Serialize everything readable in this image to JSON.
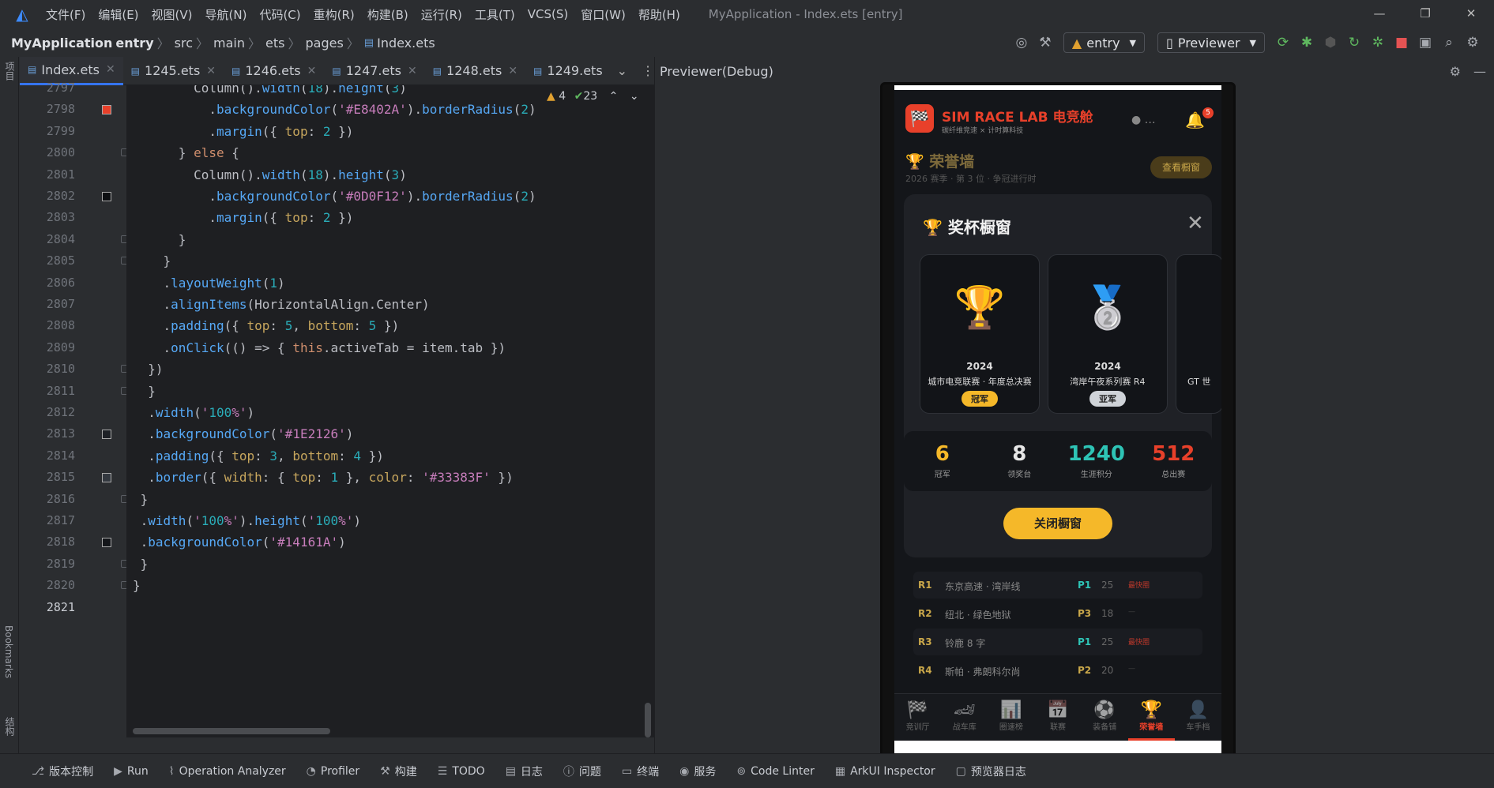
{
  "menubar": {
    "items": [
      "文件(F)",
      "编辑(E)",
      "视图(V)",
      "导航(N)",
      "代码(C)",
      "重构(R)",
      "构建(B)",
      "运行(R)",
      "工具(T)",
      "VCS(S)",
      "窗口(W)",
      "帮助(H)"
    ],
    "window_title": "MyApplication - Index.ets [entry]"
  },
  "breadcrumb": {
    "project": "MyApplication",
    "module": "entry",
    "p1": "src",
    "p2": "main",
    "p3": "ets",
    "p4": "pages",
    "file": "Index.ets"
  },
  "toolbar": {
    "module_select": "entry",
    "device_select": "Previewer"
  },
  "tabs": [
    "Index.ets",
    "1245.ets",
    "1246.ets",
    "1247.ets",
    "1248.ets",
    "1249.ets"
  ],
  "inspection": {
    "warnings": "4",
    "weak": "23"
  },
  "side": {
    "project": "项目",
    "bookmarks": "Bookmarks",
    "structure": "结构"
  },
  "code": {
    "lines": [
      {
        "n": "2797",
        "t": "        Column().width(18).height(3)"
      },
      {
        "n": "2798",
        "t": "          .backgroundColor('#E8402A').borderRadius(2)"
      },
      {
        "n": "2799",
        "t": "          .margin({ top: 2 })"
      },
      {
        "n": "2800",
        "t": "      } else {"
      },
      {
        "n": "2801",
        "t": "        Column().width(18).height(3)"
      },
      {
        "n": "2802",
        "t": "          .backgroundColor('#0D0F12').borderRadius(2)"
      },
      {
        "n": "2803",
        "t": "          .margin({ top: 2 })"
      },
      {
        "n": "2804",
        "t": "      }"
      },
      {
        "n": "2805",
        "t": "    }"
      },
      {
        "n": "2806",
        "t": "    .layoutWeight(1)"
      },
      {
        "n": "2807",
        "t": "    .alignItems(HorizontalAlign.Center)"
      },
      {
        "n": "2808",
        "t": "    .padding({ top: 5, bottom: 5 })"
      },
      {
        "n": "2809",
        "t": "    .onClick(() => { this.activeTab = item.tab })"
      },
      {
        "n": "2810",
        "t": "  })"
      },
      {
        "n": "2811",
        "t": "  }"
      },
      {
        "n": "2812",
        "t": "  .width('100%')"
      },
      {
        "n": "2813",
        "t": "  .backgroundColor('#1E2126')"
      },
      {
        "n": "2814",
        "t": "  .padding({ top: 3, bottom: 4 })"
      },
      {
        "n": "2815",
        "t": "  .border({ width: { top: 1 }, color: '#33383F' })"
      },
      {
        "n": "2816",
        "t": " }"
      },
      {
        "n": "2817",
        "t": " .width('100%').height('100%')"
      },
      {
        "n": "2818",
        "t": " .backgroundColor('#14161A')"
      },
      {
        "n": "2819",
        "t": " }"
      },
      {
        "n": "2820",
        "t": "}"
      },
      {
        "n": "2821",
        "t": ""
      }
    ],
    "swatches": {
      "2798": "#E8402A",
      "2802": "#0D0F12",
      "2813": "#1E2126",
      "2815": "#33383F",
      "2818": "#14161A"
    }
  },
  "preview": {
    "title": "Previewer(Debug)"
  },
  "app": {
    "title": "SIM RACE LAB 电竞舱",
    "subtitle": "碳纤维竞速 × 计时算料技",
    "notif_count": "5",
    "honor_title": "荣誉墙",
    "honor_sub": "2026 赛季 · 第 3 位 · 争冠进行时",
    "view_btn": "查看橱窗",
    "modal": {
      "title": "奖杯橱窗",
      "cards": [
        {
          "emoji": "🏆",
          "year": "2024",
          "name": "城市电竞联赛 · 年度总决赛",
          "rank": "冠军",
          "rank_color": "#f5b829"
        },
        {
          "emoji": "🥈",
          "year": "2024",
          "name": "湾岸午夜系列赛 R4",
          "rank": "亚军",
          "rank_color": "#cfd3d8"
        },
        {
          "emoji": "",
          "year": "",
          "name": "GT 世",
          "rank": "",
          "rank_color": ""
        }
      ],
      "stats": [
        {
          "value": "6",
          "label": "冠军",
          "color": "#f5b829"
        },
        {
          "value": "8",
          "label": "领奖台",
          "color": "#e6e6e6"
        },
        {
          "value": "1240",
          "label": "生涯积分",
          "color": "#2ec4b6"
        },
        {
          "value": "512",
          "label": "总出赛",
          "color": "#e8402a"
        }
      ],
      "close_btn": "关闭橱窗"
    },
    "races": [
      {
        "r": "R1",
        "track": "东京高速 · 湾岸线",
        "pos": "P1",
        "pts": "25",
        "flag": "最快圈"
      },
      {
        "r": "R2",
        "track": "纽北 · 绿色地狱",
        "pos": "P3",
        "pts": "18",
        "flag": "—"
      },
      {
        "r": "R3",
        "track": "铃鹿 8 字",
        "pos": "P1",
        "pts": "25",
        "flag": "最快圈"
      },
      {
        "r": "R4",
        "track": "斯帕 · 弗朗科尔尚",
        "pos": "P2",
        "pts": "20",
        "flag": "—"
      }
    ],
    "tabbar": [
      {
        "icon": "🏁",
        "label": "竞训厅"
      },
      {
        "icon": "🏎",
        "label": "战车库"
      },
      {
        "icon": "📊",
        "label": "圈速榜"
      },
      {
        "icon": "📅",
        "label": "联赛"
      },
      {
        "icon": "⚽",
        "label": "装备铺"
      },
      {
        "icon": "🏆",
        "label": "荣誉墙",
        "active": true
      },
      {
        "icon": "👤",
        "label": "车手档"
      }
    ]
  },
  "bottombar": [
    "版本控制",
    "Run",
    "Operation Analyzer",
    "Profiler",
    "构建",
    "TODO",
    "日志",
    "问题",
    "终端",
    "服务",
    "Code Linter",
    "ArkUI Inspector",
    "预览器日志"
  ]
}
